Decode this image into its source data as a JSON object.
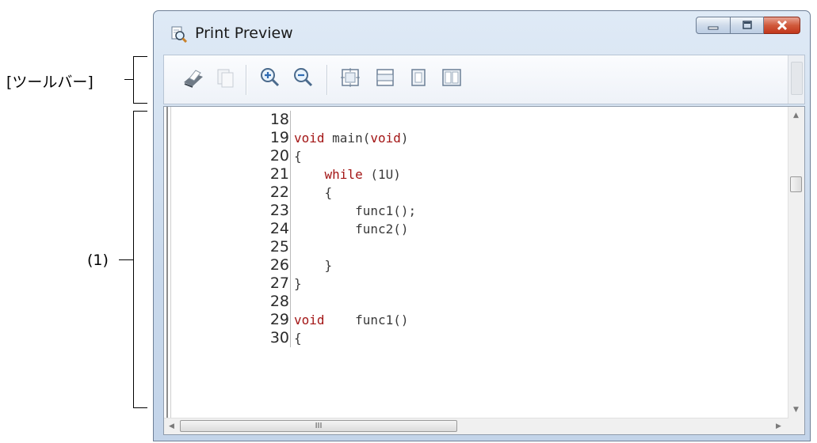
{
  "annotations": {
    "toolbar_label": "[ツールバー]",
    "area_label": "(1)"
  },
  "window": {
    "title": "Print Preview",
    "title_icon": "print-preview-icon",
    "caption_buttons": [
      "minimize-icon",
      "maximize-icon",
      "close-icon"
    ]
  },
  "toolbar": {
    "buttons": [
      "print-icon",
      "copy-icon",
      "zoom-in-icon",
      "zoom-out-icon",
      "fit-page-icon",
      "fit-width-icon",
      "single-page-icon",
      "two-pages-icon"
    ]
  },
  "preview": {
    "lines": [
      {
        "num": "18",
        "parts": []
      },
      {
        "num": "19",
        "parts": [
          {
            "t": "void",
            "kw": true
          },
          {
            "t": " main(",
            "kw": false
          },
          {
            "t": "void",
            "kw": true
          },
          {
            "t": ")",
            "kw": false
          }
        ]
      },
      {
        "num": "20",
        "parts": [
          {
            "t": "{",
            "kw": false
          }
        ]
      },
      {
        "num": "21",
        "parts": [
          {
            "t": "    ",
            "kw": false
          },
          {
            "t": "while",
            "kw": true
          },
          {
            "t": " (1U)",
            "kw": false
          }
        ]
      },
      {
        "num": "22",
        "parts": [
          {
            "t": "    {",
            "kw": false
          }
        ]
      },
      {
        "num": "23",
        "parts": [
          {
            "t": "        func1();",
            "kw": false
          }
        ]
      },
      {
        "num": "24",
        "parts": [
          {
            "t": "        func2()",
            "kw": false
          }
        ]
      },
      {
        "num": "25",
        "parts": []
      },
      {
        "num": "26",
        "parts": [
          {
            "t": "    }",
            "kw": false
          }
        ]
      },
      {
        "num": "27",
        "parts": [
          {
            "t": "}",
            "kw": false
          }
        ]
      },
      {
        "num": "28",
        "parts": []
      },
      {
        "num": "29",
        "parts": [
          {
            "t": "void",
            "kw": true
          },
          {
            "t": "    func1()",
            "kw": false
          }
        ]
      },
      {
        "num": "30",
        "parts": [
          {
            "t": "{",
            "kw": false
          }
        ]
      }
    ],
    "hscroll_grip": "III"
  },
  "colors": {
    "keyword": "#a31515",
    "window_frame": "#c9d9ec"
  }
}
